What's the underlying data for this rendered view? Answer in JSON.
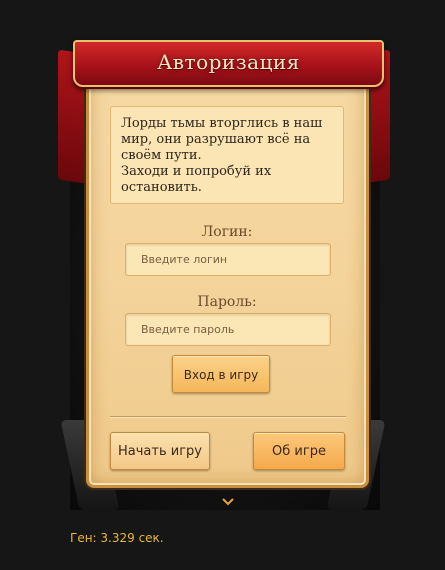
{
  "banner": {
    "title": "Авторизация"
  },
  "message": {
    "lines": [
      "Лорды тьмы вторглись в наш",
      "мир, они разрушают всё на",
      "своём пути.",
      "Заходи и попробуй их",
      "остановить."
    ]
  },
  "login": {
    "label": "Логин:",
    "placeholder": "Введите логин",
    "value": ""
  },
  "password": {
    "label": "Пароль:",
    "placeholder": "Введите пароль",
    "value": ""
  },
  "buttons": {
    "login": "Вход в игру",
    "start": "Начать игру",
    "about": "Об игре"
  },
  "footer": {
    "gen": "Ген: 3.329 сек."
  },
  "colors": {
    "banner_red": "#a8121a",
    "panel_parchment": "#f6d9a3",
    "accent_orange": "#f4b75a",
    "gen_text": "#e8b830",
    "background": "#161616"
  },
  "icons": {
    "scroll_indicator": "chevron-down-icon"
  }
}
